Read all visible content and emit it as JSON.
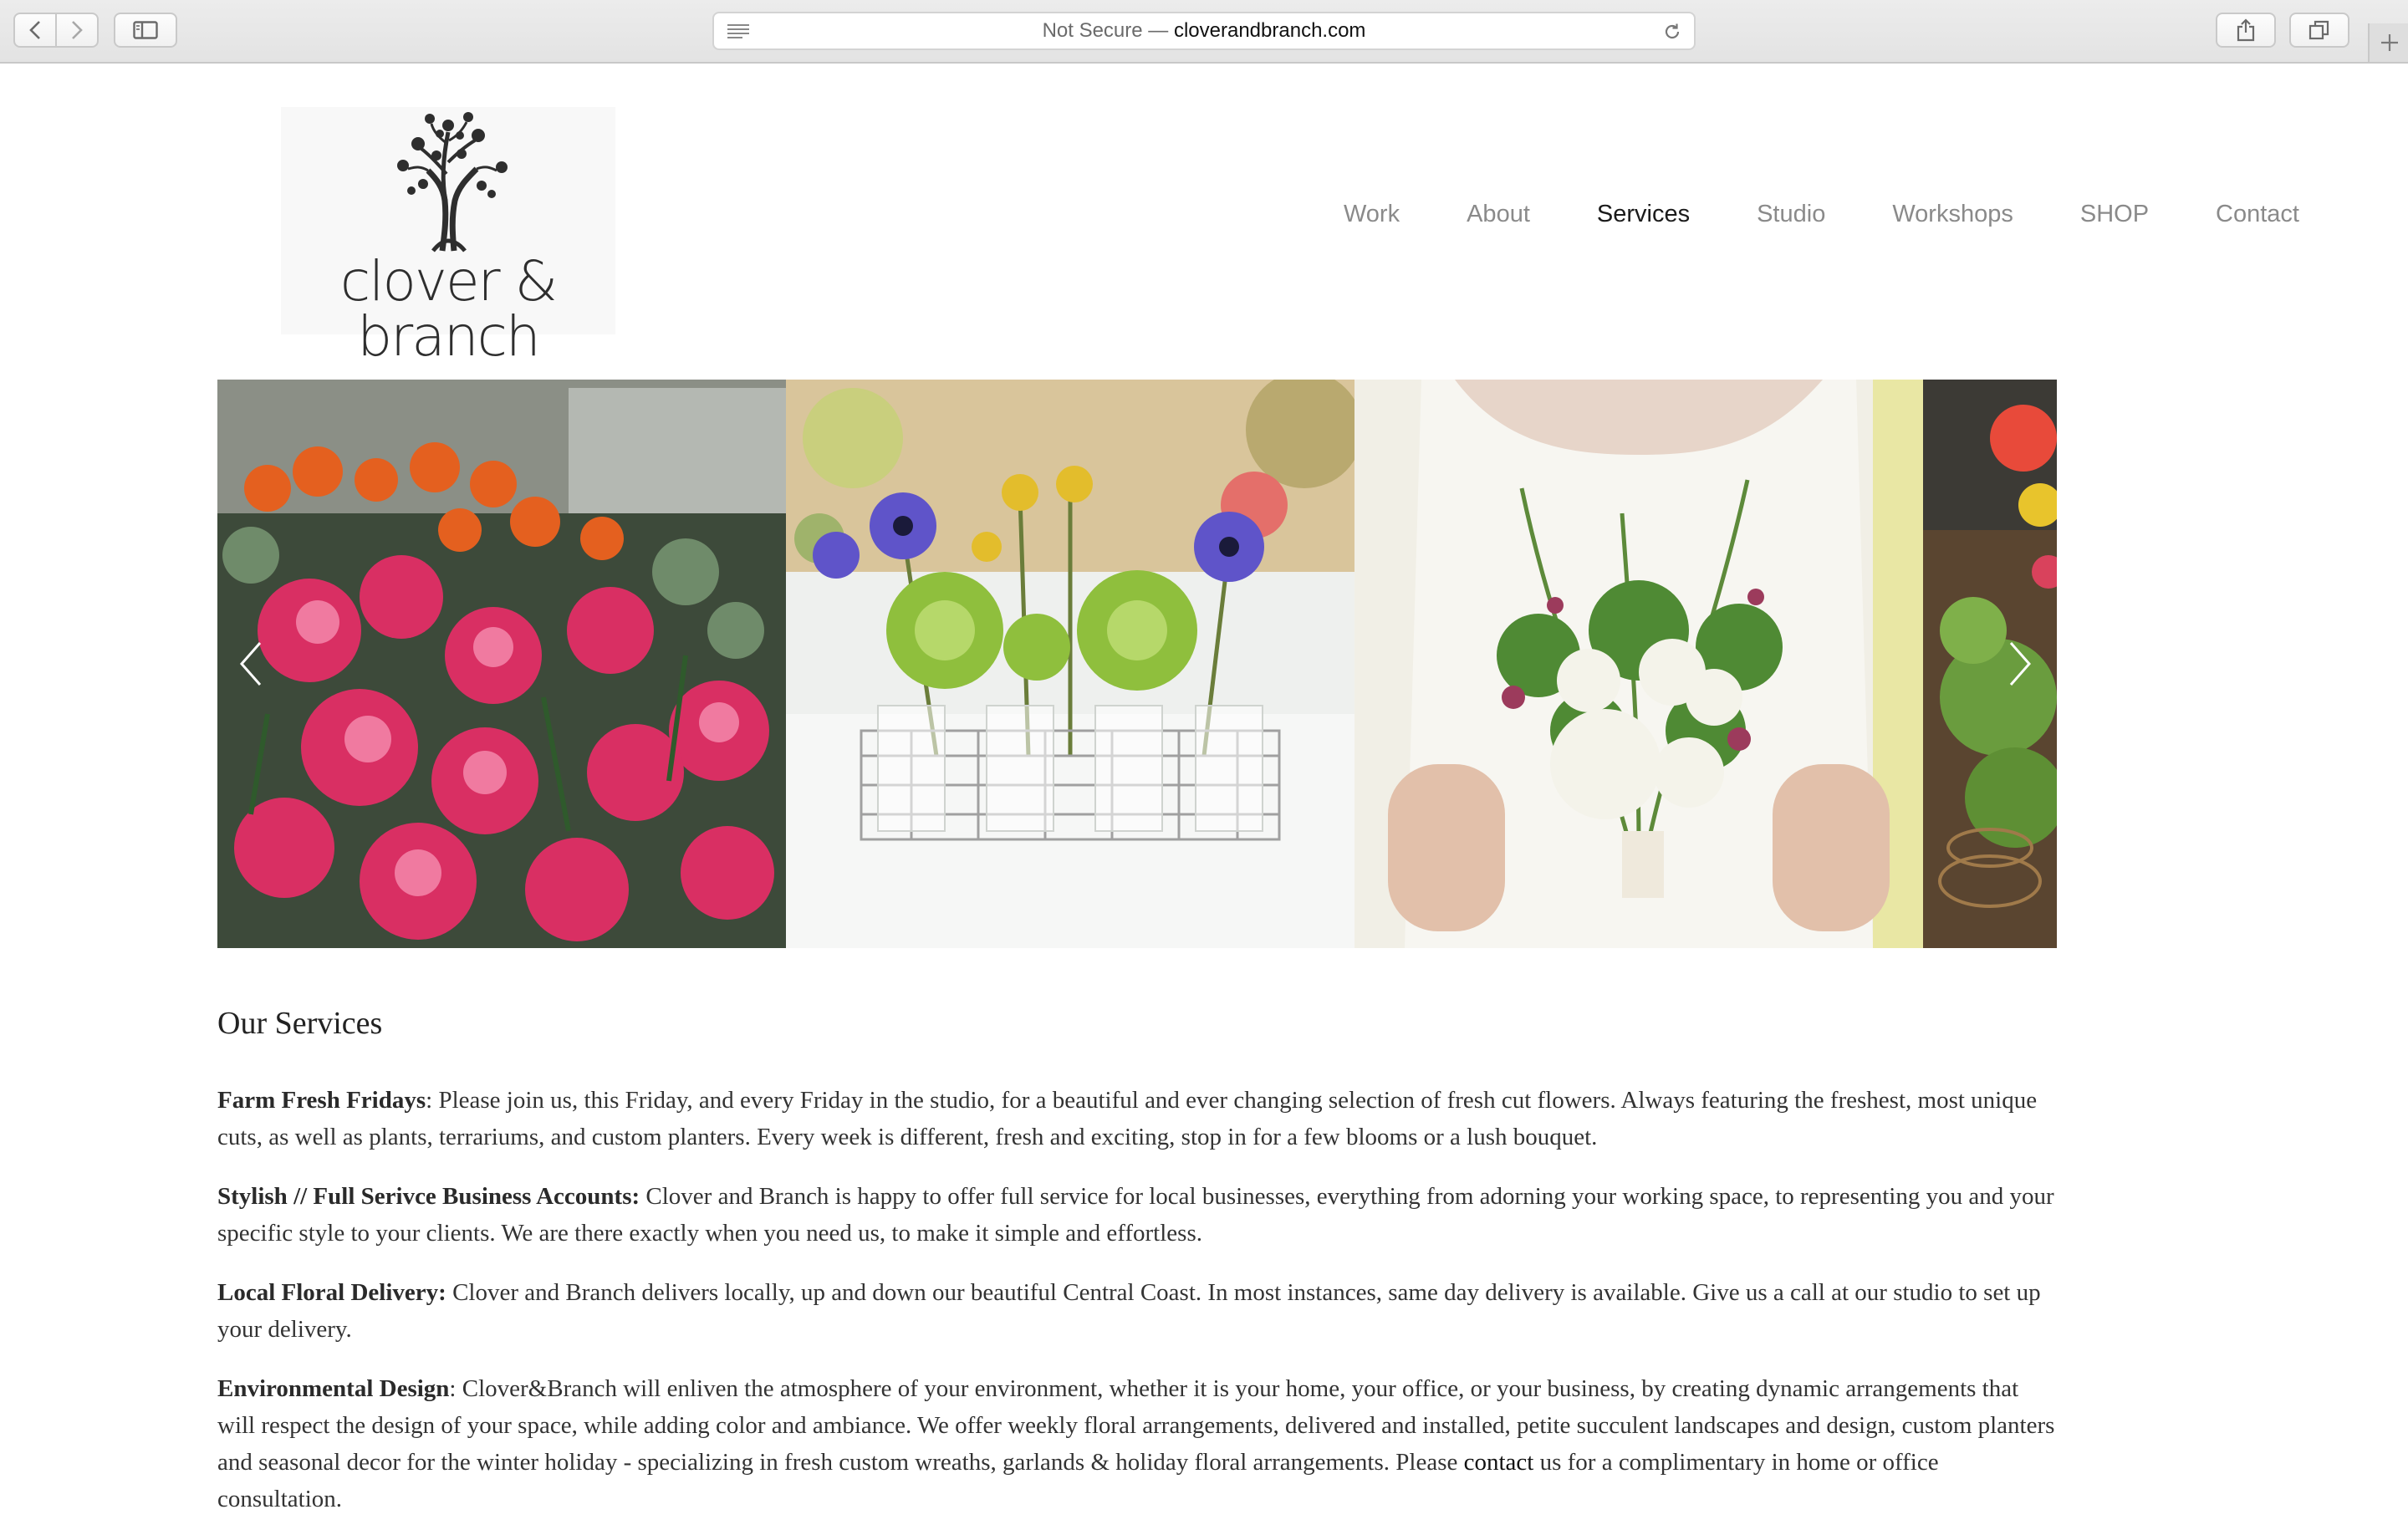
{
  "browser": {
    "url_prefix": "Not Secure — ",
    "url_host": "cloverandbranch.com"
  },
  "site": {
    "logo_text": "clover & branch",
    "nav": [
      "Work",
      "About",
      "Services",
      "Studio",
      "Workshops",
      "SHOP",
      "Contact"
    ],
    "active_nav": "Services"
  },
  "colors": {
    "text": "#333333",
    "nav_inactive": "#8a8a8a",
    "nav_active": "#1a1a1a"
  },
  "services": {
    "heading": "Our Services",
    "items": [
      {
        "title": "Farm Fresh Fridays",
        "sep": ":",
        "text": " Please join us, this Friday, and every Friday in the studio, for a beautiful and ever changing selection of fresh cut flowers. Always featuring the freshest, most unique cuts, as well as plants, terrariums, and custom planters. Every week is different, fresh and exciting, stop in for a few blooms or a lush bouquet."
      },
      {
        "title": "Stylish // Full Serivce Business Accounts:",
        "sep": "",
        "text": " Clover and Branch is happy to offer full service for local businesses, everything from adorning your working space, to representing you and your specific style to your clients.  We are there exactly when you need us, to make it simple and effortless."
      },
      {
        "title": "Local Floral Delivery:",
        "sep": "",
        "text": " Clover and Branch delivers locally, up and down our beautiful Central Coast.  In most instances, same day delivery is available.  Give us a call at our studio to set up your delivery."
      },
      {
        "title": "Environmental Design",
        "sep": ":",
        "text": " Clover&Branch will enliven the atmosphere of your environment, whether it is your home, your office, or your business, by creating dynamic arrangements that will respect the design of your space, while adding color and ambiance. We offer weekly floral arrangements, delivered and installed,  petite succulent landscapes and design, custom planters and seasonal decor for the winter holiday - specializing in fresh custom wreaths, garlands & holiday floral arrangements. Please ",
        "link": "contact",
        "text_after": " us for a complimentary in home or office consultation."
      }
    ]
  }
}
